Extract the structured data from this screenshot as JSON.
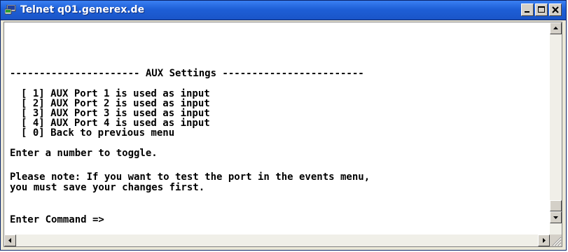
{
  "window": {
    "title": "Telnet q01.generex.de",
    "icon": "telnet-app-icon"
  },
  "caption_buttons": {
    "minimize": "minimize-icon",
    "maximize": "maximize-icon",
    "close": "close-icon"
  },
  "console": {
    "header": "---------------------- AUX Settings ------------------------",
    "menu_items": [
      "[ 1] AUX Port 1 is used as input",
      "[ 2] AUX Port 2 is used as input",
      "[ 3] AUX Port 3 is used as input",
      "[ 4] AUX Port 4 is used as input",
      "[ 0] Back to previous menu"
    ],
    "instruction": "Enter a number to toggle.",
    "note_line1": "Please note: If you want to test the port in the events menu,",
    "note_line2": "you must save your changes first.",
    "prompt": "Enter Command =>"
  }
}
